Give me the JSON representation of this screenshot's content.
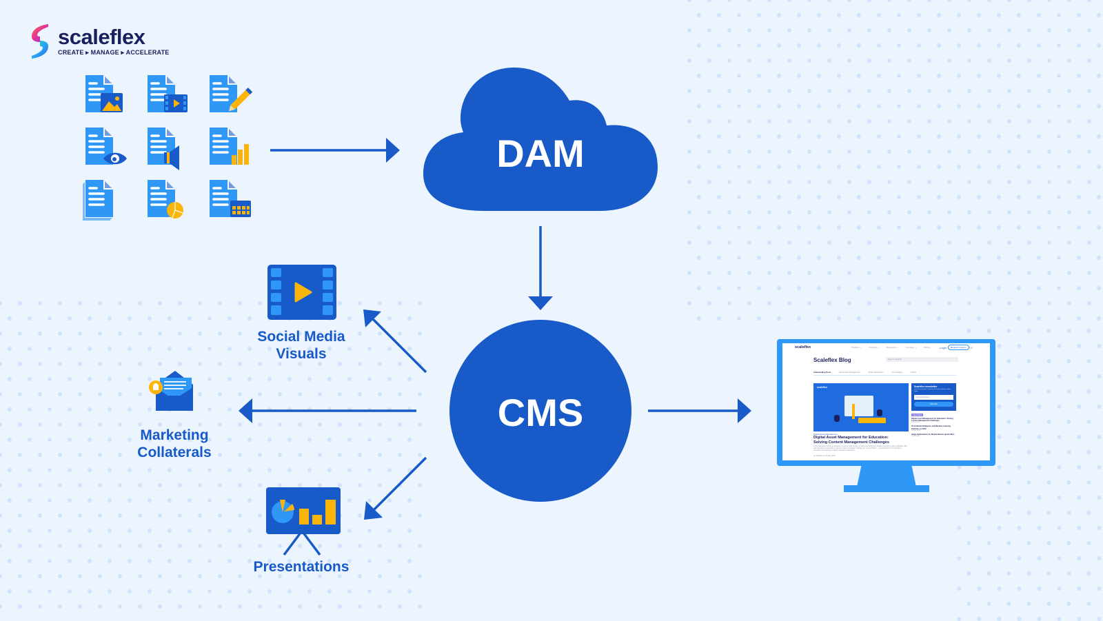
{
  "brand": {
    "name": "scaleflex",
    "tagline": "CREATE ▸ MANAGE ▸ ACCELERATE"
  },
  "colors": {
    "background": "#ecf4fe",
    "primary_blue": "#175ac8",
    "light_blue": "#2f97f5",
    "accent_yellow": "#fbb40a",
    "dot_color": "#cfe4fc",
    "brand_navy": "#1b1f5e"
  },
  "diagram": {
    "source_assets": {
      "icons": [
        "document-image-icon",
        "document-video-icon",
        "document-edit-icon",
        "document-view-icon",
        "document-audio-icon",
        "document-chart-icon",
        "document-stack-icon",
        "document-pie-chart-icon",
        "document-calendar-icon"
      ]
    },
    "dam": {
      "label": "DAM"
    },
    "cms": {
      "label": "CMS"
    },
    "outputs": [
      {
        "id": "social",
        "label_line1": "Social Media",
        "label_line2": "Visuals",
        "icon": "video-film-icon"
      },
      {
        "id": "marketing",
        "label_line1": "Marketing",
        "label_line2": "Collaterals",
        "icon": "envelope-notification-icon"
      },
      {
        "id": "presentations",
        "label_line1": "Presentations",
        "label_line2": "",
        "icon": "presentation-board-icon"
      },
      {
        "id": "website",
        "label_line1": "",
        "label_line2": "",
        "icon": "monitor-icon"
      }
    ],
    "edges": [
      {
        "from": "source_assets",
        "to": "dam"
      },
      {
        "from": "dam",
        "to": "cms"
      },
      {
        "from": "cms",
        "to": "social"
      },
      {
        "from": "cms",
        "to": "marketing"
      },
      {
        "from": "cms",
        "to": "presentations"
      },
      {
        "from": "cms",
        "to": "website"
      }
    ]
  },
  "website_preview": {
    "logo": "scaleflex",
    "nav": [
      "Products ⌄",
      "Solutions ⌄",
      "Resources ⌄",
      "Company ⌄",
      "Pricing"
    ],
    "login": "Login ⌄",
    "cta": "Request a Demo",
    "lang": "EN",
    "title": "Scaleflex Blog",
    "search_placeholder": "Type to Search",
    "tabs": [
      "Featured Blog Posts",
      "Digital Asset Management",
      "Media Optimization",
      "Our Solutions",
      "Others"
    ],
    "hero": {
      "logo": "scaleflex",
      "category": "Digital Asset Management",
      "title_line1": "Digital Asset Management for Education:",
      "title_line2": "Solving Content Management Challenges",
      "excerpt": "In the fast-paced world of education, it can be hard to keep up with everything from student records to class schedules. But one thing that's impossible to ignore is that technology is taking over every industry – and education is no exception. Research and learning in higher education institutions...",
      "byline": "by Scaleflex on 16 Nov 2023"
    },
    "newsletter": {
      "title": "Scaleflex newsletter",
      "text": "Join the newsletter to receive the latest updates in your inbox.",
      "email_placeholder": "Your email address",
      "button": "Subscribe"
    },
    "latest": {
      "badge": "Latest Posts",
      "items": [
        {
          "title": "Digital Asset Management for Education: Solving Content Management Challenges",
          "date": "16 Nov 2023"
        },
        {
          "title": "35 Artificial Intelligence and Machine Learning Statistics as 2023",
          "date": "02 Nov 2023"
        },
        {
          "title": "Image Optimization for Mobile Devices Quick Wins",
          "date": "26 Oct 2023"
        }
      ]
    }
  }
}
